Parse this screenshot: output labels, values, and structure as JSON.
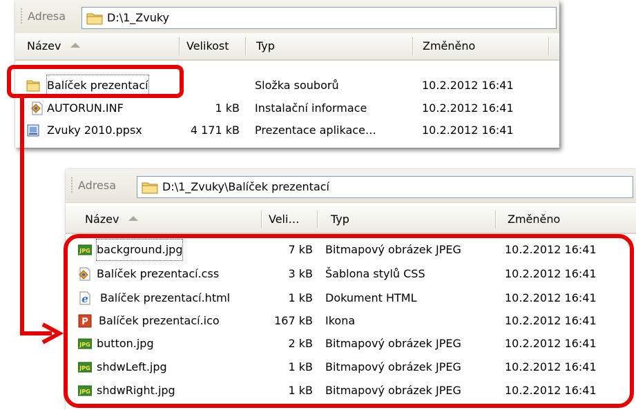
{
  "window1": {
    "address_label": "Adresa",
    "address_path": "D:\\1_Zvuky",
    "columns": {
      "name": "Název",
      "size": "Velikost",
      "type": "Typ",
      "modified": "Změněno"
    },
    "rows": [
      {
        "name": "Balíček prezentací",
        "size": "",
        "type": "Složka souborů",
        "modified": "10.2.2012 16:41",
        "icon": "folder-icon"
      },
      {
        "name": "AUTORUN.INF",
        "size": "1 kB",
        "type": "Instalační informace",
        "modified": "10.2.2012 16:41",
        "icon": "setup-info-icon"
      },
      {
        "name": "Zvuky 2010.ppsx",
        "size": "4 171 kB",
        "type": "Prezentace aplikace…",
        "modified": "10.2.2012 16:41",
        "icon": "powerpoint-show-icon"
      }
    ]
  },
  "window2": {
    "address_label": "Adresa",
    "address_path": "D:\\1_Zvuky\\Balíček prezentací",
    "columns": {
      "name": "Název",
      "size": "Veli…",
      "type": "Typ",
      "modified": "Změněno"
    },
    "rows": [
      {
        "name": "background.jpg",
        "size": "7 kB",
        "type": "Bitmapový obrázek JPEG",
        "modified": "10.2.2012 16:41",
        "icon": "jpg-icon"
      },
      {
        "name": "Balíček prezentací.css",
        "size": "3 kB",
        "type": "Šablona stylů CSS",
        "modified": "10.2.2012 16:41",
        "icon": "css-icon"
      },
      {
        "name": "Balíček prezentací.html",
        "size": "1 kB",
        "type": "Dokument HTML",
        "modified": "10.2.2012 16:41",
        "icon": "ie-html-icon"
      },
      {
        "name": "Balíček prezentací.ico",
        "size": "167 kB",
        "type": "Ikona",
        "modified": "10.2.2012 16:41",
        "icon": "ppt-ico-icon"
      },
      {
        "name": "button.jpg",
        "size": "2 kB",
        "type": "Bitmapový obrázek JPEG",
        "modified": "10.2.2012 16:41",
        "icon": "jpg-icon"
      },
      {
        "name": "shdwLeft.jpg",
        "size": "1 kB",
        "type": "Bitmapový obrázek JPEG",
        "modified": "10.2.2012 16:41",
        "icon": "jpg-icon"
      },
      {
        "name": "shdwRight.jpg",
        "size": "1 kB",
        "type": "Bitmapový obrázek JPEG",
        "modified": "10.2.2012 16:41",
        "icon": "jpg-icon"
      }
    ]
  },
  "colors": {
    "highlight": "#e60000",
    "address_border": "#7f9db9",
    "folder": "#f5d36a"
  }
}
